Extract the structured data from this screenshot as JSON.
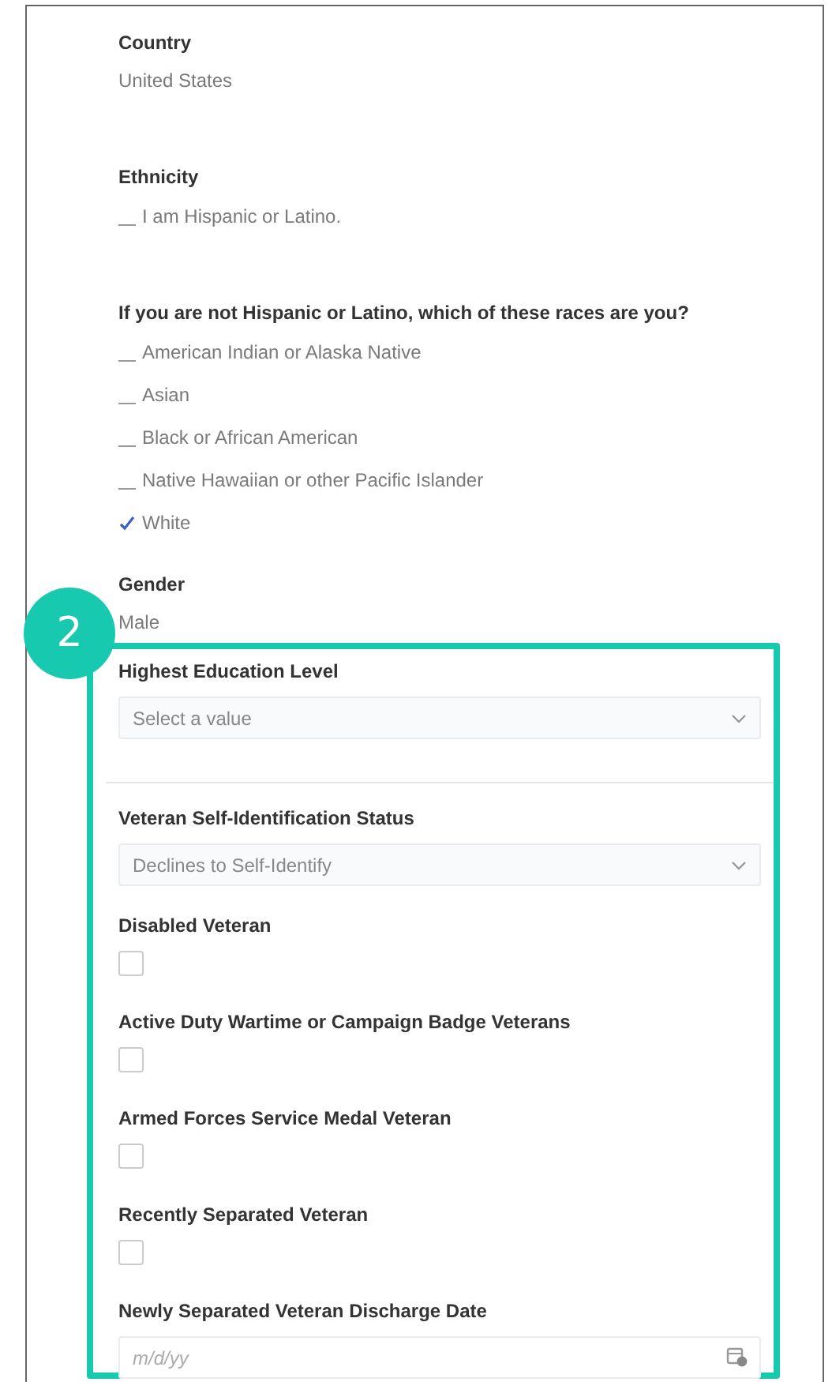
{
  "fields": [
    {
      "kind": "static",
      "label": "Country",
      "value": "United States"
    },
    {
      "kind": "checklist",
      "label": "Ethnicity",
      "options": [
        {
          "label": "I am Hispanic or Latino.",
          "checked": false
        }
      ]
    },
    {
      "kind": "checklist",
      "label": "If you are not Hispanic or Latino, which of these races are you?",
      "options": [
        {
          "label": "American Indian or Alaska Native",
          "checked": false
        },
        {
          "label": "Asian",
          "checked": false
        },
        {
          "label": "Black or African American",
          "checked": false
        },
        {
          "label": "Native Hawaiian or other Pacific Islander",
          "checked": false
        },
        {
          "label": "White",
          "checked": true
        }
      ]
    },
    {
      "kind": "static",
      "label": "Gender",
      "value": "Male"
    }
  ],
  "highlight": {
    "badge": "2",
    "sections": [
      [
        {
          "kind": "dropdown",
          "label": "Highest Education Level",
          "placeholder": "Select a value"
        }
      ],
      [
        {
          "kind": "dropdown",
          "label": "Veteran Self-Identification Status",
          "value": "Declines to Self-Identify"
        },
        {
          "kind": "checkbox",
          "label": "Disabled Veteran",
          "checked": false
        },
        {
          "kind": "checkbox",
          "label": "Active Duty Wartime or Campaign Badge Veterans",
          "checked": false
        },
        {
          "kind": "checkbox",
          "label": "Armed Forces Service Medal Veteran",
          "checked": false
        },
        {
          "kind": "checkbox",
          "label": "Recently Separated Veteran",
          "checked": false
        },
        {
          "kind": "date",
          "label": "Newly Separated Veteran Discharge Date",
          "placeholder": "m/d/yy"
        }
      ]
    ]
  }
}
